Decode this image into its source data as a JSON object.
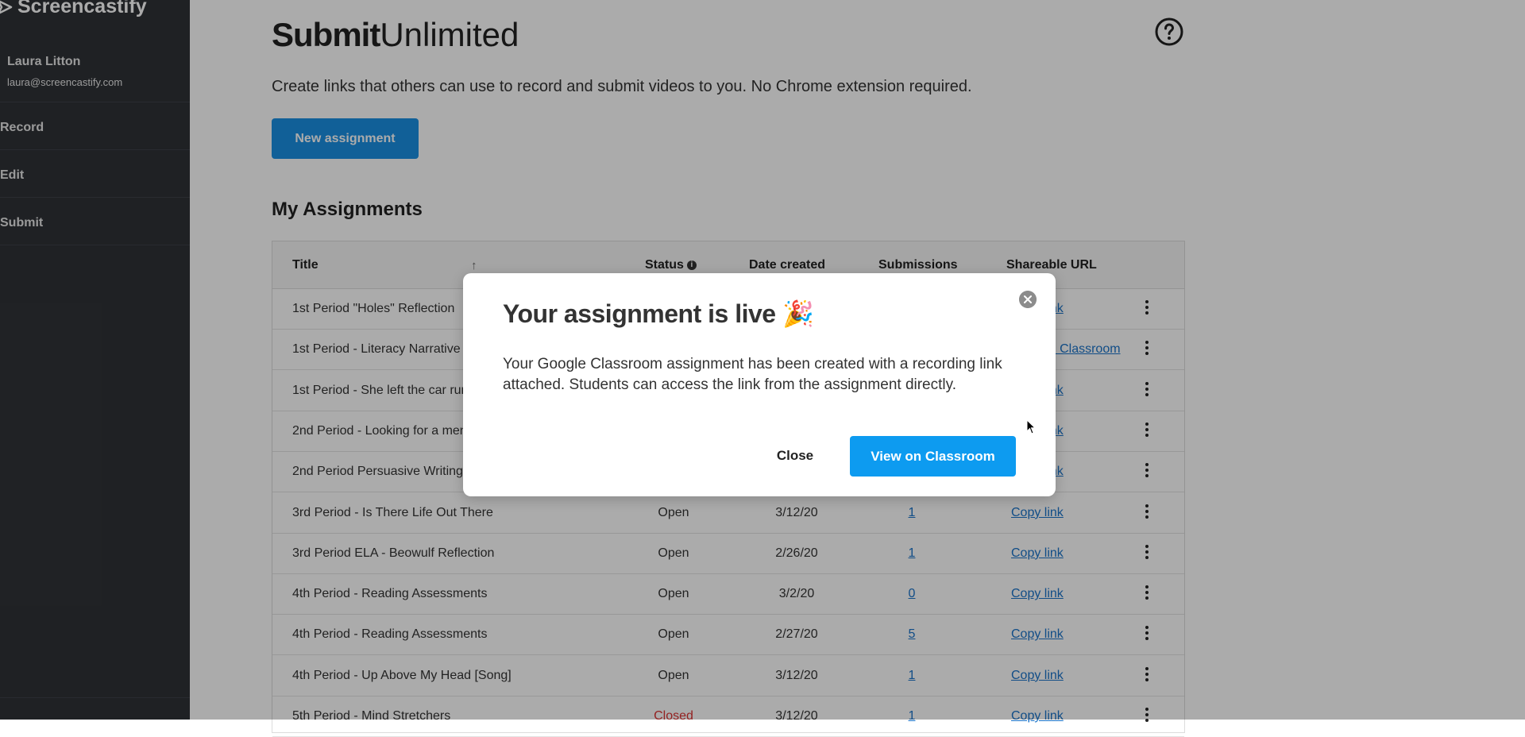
{
  "sidebar": {
    "brand": "Screencastify",
    "user_name": "Laura Litton",
    "user_email": "laura@screencastify.com",
    "nav": [
      "Record",
      "Edit",
      "Submit"
    ]
  },
  "header": {
    "title_bold": "Submit",
    "title_rest": "Unlimited",
    "subtitle": "Create links that others can use to record and submit videos to you. No Chrome extension required.",
    "new_button": "New assignment",
    "help_icon": "question-circle-icon"
  },
  "assignments": {
    "heading": "My Assignments",
    "columns": [
      "Title",
      "Status",
      "Date created",
      "Submissions",
      "Shareable URL"
    ],
    "rows": [
      {
        "title": "1st Period \"Holes\" Reflection",
        "status": "",
        "date": "",
        "subs": "",
        "url": "Copy link"
      },
      {
        "title": "1st Period - Literacy Narrative",
        "status": "",
        "date": "",
        "subs": "",
        "url": "View on Classroom"
      },
      {
        "title": "1st Period - She left the car running",
        "status": "",
        "date": "",
        "subs": "",
        "url": "Copy link"
      },
      {
        "title": "2nd Period - Looking for a mentor",
        "status": "",
        "date": "",
        "subs": "",
        "url": "Copy link"
      },
      {
        "title": "2nd Period Persuasive Writing",
        "status": "",
        "date": "",
        "subs": "",
        "url": "Copy link"
      },
      {
        "title": "3rd Period - Is There Life Out There",
        "status": "Open",
        "date": "3/12/20",
        "subs": "1",
        "url": "Copy link"
      },
      {
        "title": "3rd Period ELA - Beowulf Reflection",
        "status": "Open",
        "date": "2/26/20",
        "subs": "1",
        "url": "Copy link"
      },
      {
        "title": "4th Period - Reading Assessments",
        "status": "Open",
        "date": "3/2/20",
        "subs": "0",
        "url": "Copy link"
      },
      {
        "title": "4th Period - Reading Assessments",
        "status": "Open",
        "date": "2/27/20",
        "subs": "5",
        "url": "Copy link"
      },
      {
        "title": "4th Period - Up Above My Head [Song]",
        "status": "Open",
        "date": "3/12/20",
        "subs": "1",
        "url": "Copy link"
      },
      {
        "title": "5th Period - Mind Stretchers",
        "status": "Closed",
        "date": "3/12/20",
        "subs": "1",
        "url": "Copy link"
      }
    ]
  },
  "modal": {
    "title": "Your assignment is live 🎉",
    "body": "Your Google Classroom assignment has been created with a recording link attached. Students can access the link from the assignment directly.",
    "close_label": "Close",
    "view_label": "View on Classroom"
  },
  "colors": {
    "sidebar_bg": "#2f3237",
    "primary_button": "#1a8fe3",
    "modal_button": "#0d9bf0",
    "link": "#1a73c9",
    "closed_status": "#d33"
  }
}
